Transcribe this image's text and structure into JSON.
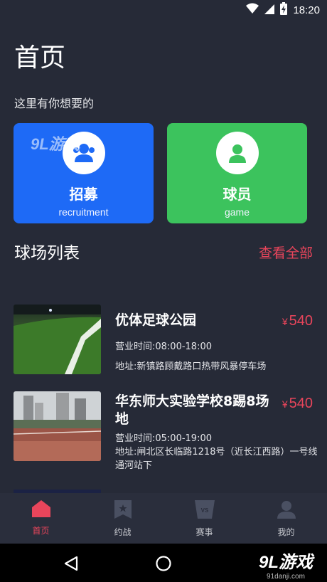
{
  "status": {
    "time": "18:20"
  },
  "page": {
    "title": "首页",
    "subtitle": "这里有你想要的"
  },
  "cards": [
    {
      "name": "招募",
      "sub": "recruitment",
      "icon": "group-icon",
      "color": "#1E6AF6"
    },
    {
      "name": "球员",
      "sub": "game",
      "icon": "user-icon",
      "color": "#3CC35D"
    }
  ],
  "section": {
    "title": "球场列表",
    "view_all": "查看全部"
  },
  "venues": [
    {
      "name": "优体足球公园",
      "price": "540",
      "currency": "¥",
      "hours": "营业时间:08:00-18:00",
      "address": "地址:新镇路顾戴路口热带风暴停车场"
    },
    {
      "name": "华东师大实验学校8踢8场地",
      "price": "540",
      "currency": "¥",
      "hours": "营业时间:05:00-19:00",
      "address": "地址:闸北区长临路1218号（近长江西路）一号线通河站下"
    }
  ],
  "nav": [
    {
      "label": "首页",
      "icon": "home-icon",
      "active": true
    },
    {
      "label": "约战",
      "icon": "bookmark-star-icon",
      "active": false
    },
    {
      "label": "赛事",
      "icon": "versus-icon",
      "active": false
    },
    {
      "label": "我的",
      "icon": "profile-icon",
      "active": false
    }
  ],
  "watermark": {
    "logo": "9L游戏",
    "site": "91danji.com",
    "inline": "9L游戏"
  },
  "colors": {
    "background": "#262A37",
    "accent": "#E8455B",
    "nav_bg": "#2A2E3C"
  }
}
